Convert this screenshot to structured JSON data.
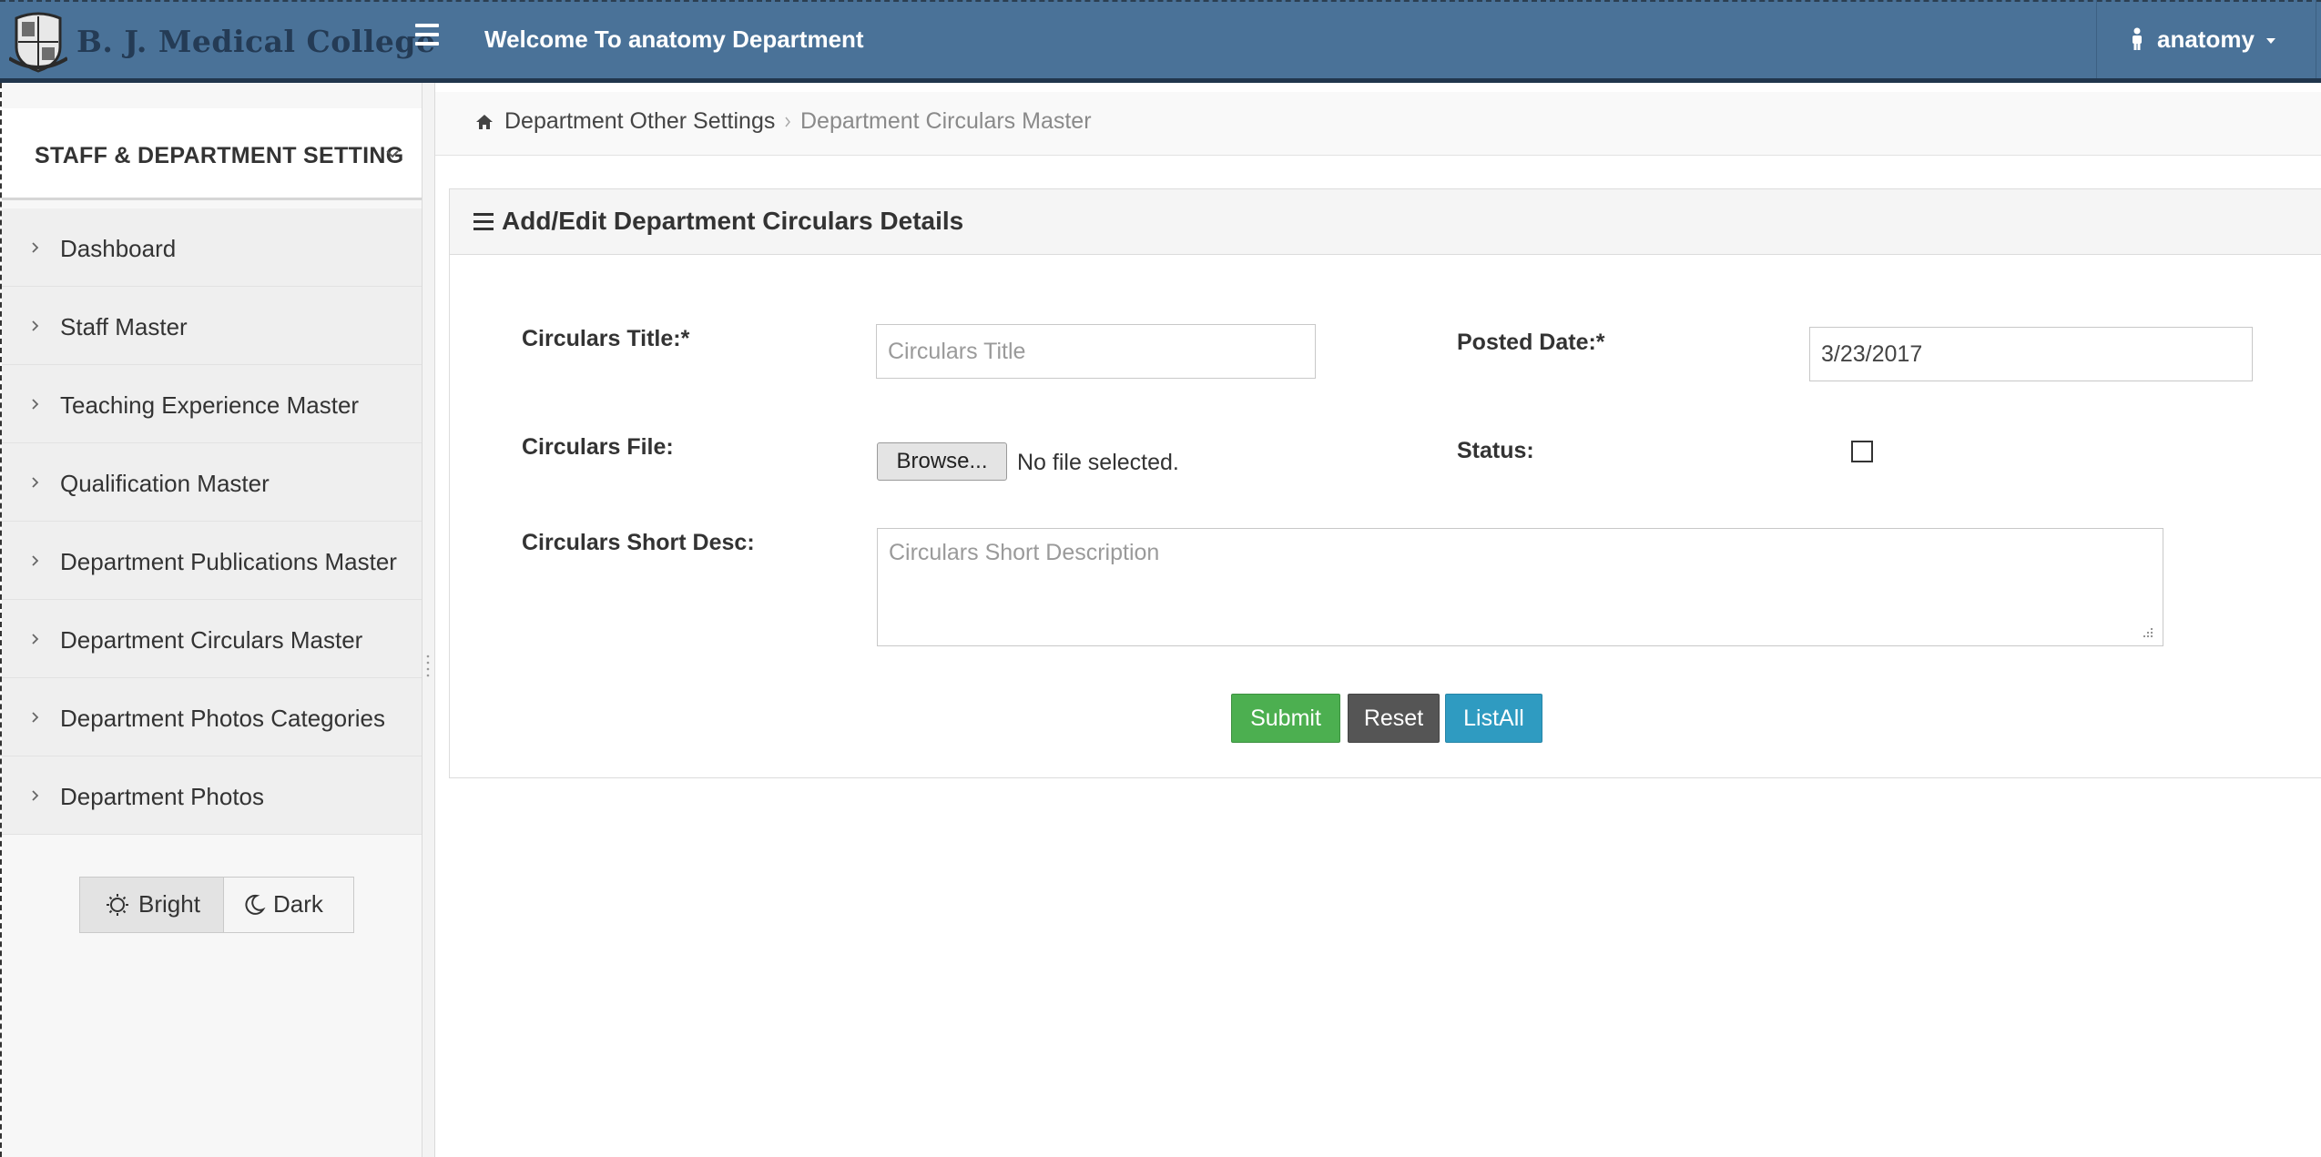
{
  "header": {
    "brand": "B. J. Medical College",
    "welcome": "Welcome To anatomy Department",
    "user": "anatomy"
  },
  "sidebar": {
    "section_title": "STAFF & DEPARTMENT SETTING",
    "items": [
      {
        "label": "Dashboard"
      },
      {
        "label": "Staff Master"
      },
      {
        "label": "Teaching Experience Master"
      },
      {
        "label": "Qualification Master"
      },
      {
        "label": "Department Publications Master"
      },
      {
        "label": "Department Circulars Master"
      },
      {
        "label": "Department Photos Categories"
      },
      {
        "label": "Department Photos"
      }
    ],
    "theme": {
      "bright": "Bright",
      "dark": "Dark",
      "selected": "Bright"
    }
  },
  "breadcrumb": {
    "parent": "Department Other Settings",
    "current": "Department Circulars Master"
  },
  "form": {
    "title": "Add/Edit Department Circulars Details",
    "circulars_title": {
      "label": "Circulars Title:*",
      "placeholder": "Circulars Title",
      "value": ""
    },
    "posted_date": {
      "label": "Posted Date:*",
      "value": "3/23/2017"
    },
    "circulars_file": {
      "label": "Circulars File:",
      "browse_label": "Browse...",
      "no_file": "No file selected."
    },
    "status": {
      "label": "Status:",
      "checked": false
    },
    "short_desc": {
      "label": "Circulars Short Desc:",
      "placeholder": "Circulars Short Description"
    },
    "buttons": {
      "submit": "Submit",
      "reset": "Reset",
      "list_all": "ListAll"
    }
  },
  "colors": {
    "header_bg": "#4a7298",
    "header_border": "#21364d",
    "submit": "#4caf50",
    "reset": "#555555",
    "list_all": "#2f9bc1"
  }
}
